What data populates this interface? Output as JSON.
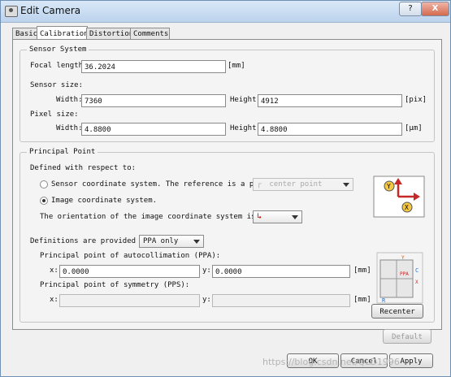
{
  "window": {
    "title": "Edit Camera",
    "help_label": "?",
    "close_label": "X"
  },
  "tabs": [
    {
      "label": "Basic"
    },
    {
      "label": "Calibration"
    },
    {
      "label": "Distortion"
    },
    {
      "label": "Comments"
    }
  ],
  "sensor": {
    "legend": "Sensor System",
    "focal_label": "Focal length:",
    "focal_value": "36.2024",
    "focal_unit": "[mm]",
    "size_label": "Sensor size:",
    "size_width_label": "Width:",
    "size_width_value": "7360",
    "size_height_label": "Height:",
    "size_height_value": "4912",
    "size_unit": "[pix]",
    "pixel_label": "Pixel size:",
    "pixel_width_label": "Width:",
    "pixel_width_value": "4.8800",
    "pixel_height_label": "Height:",
    "pixel_height_value": "4.8800",
    "pixel_unit": "[μm]"
  },
  "principal": {
    "legend": "Principal Point",
    "defined_label": "Defined with respect to:",
    "sensor_radio_label": "Sensor coordinate system. The reference is a pixel's",
    "sensor_select": "center point",
    "image_radio_label": "Image coordinate system.",
    "orientation_label": "The orientation of the image coordinate system is set to",
    "definitions_label": "Definitions are provided for",
    "definitions_select": "PPA only",
    "ppa_label": "Principal point of autocollimation (PPA):",
    "ppa_x_label": "x:",
    "ppa_x_value": "0.0000",
    "ppa_y_label": "y:",
    "ppa_y_value": "0.0000",
    "ppa_unit": "[mm]",
    "pps_label": "Principal point of symmetry (PPS):",
    "pps_x_label": "x:",
    "pps_x_value": "",
    "pps_y_label": "y:",
    "pps_y_value": "",
    "pps_unit": "[mm]",
    "recenter_label": "Recenter",
    "diagram": {
      "y_label": "Y",
      "x_label": "X",
      "ppa_label": "PPA",
      "c_label": "C",
      "r_label": "R"
    }
  },
  "footer": {
    "default_label": "Default",
    "ok_label": "OK",
    "cancel_label": "Cancel",
    "apply_label": "Apply"
  },
  "watermark": "https://blog.csdn.net/QLD1996"
}
